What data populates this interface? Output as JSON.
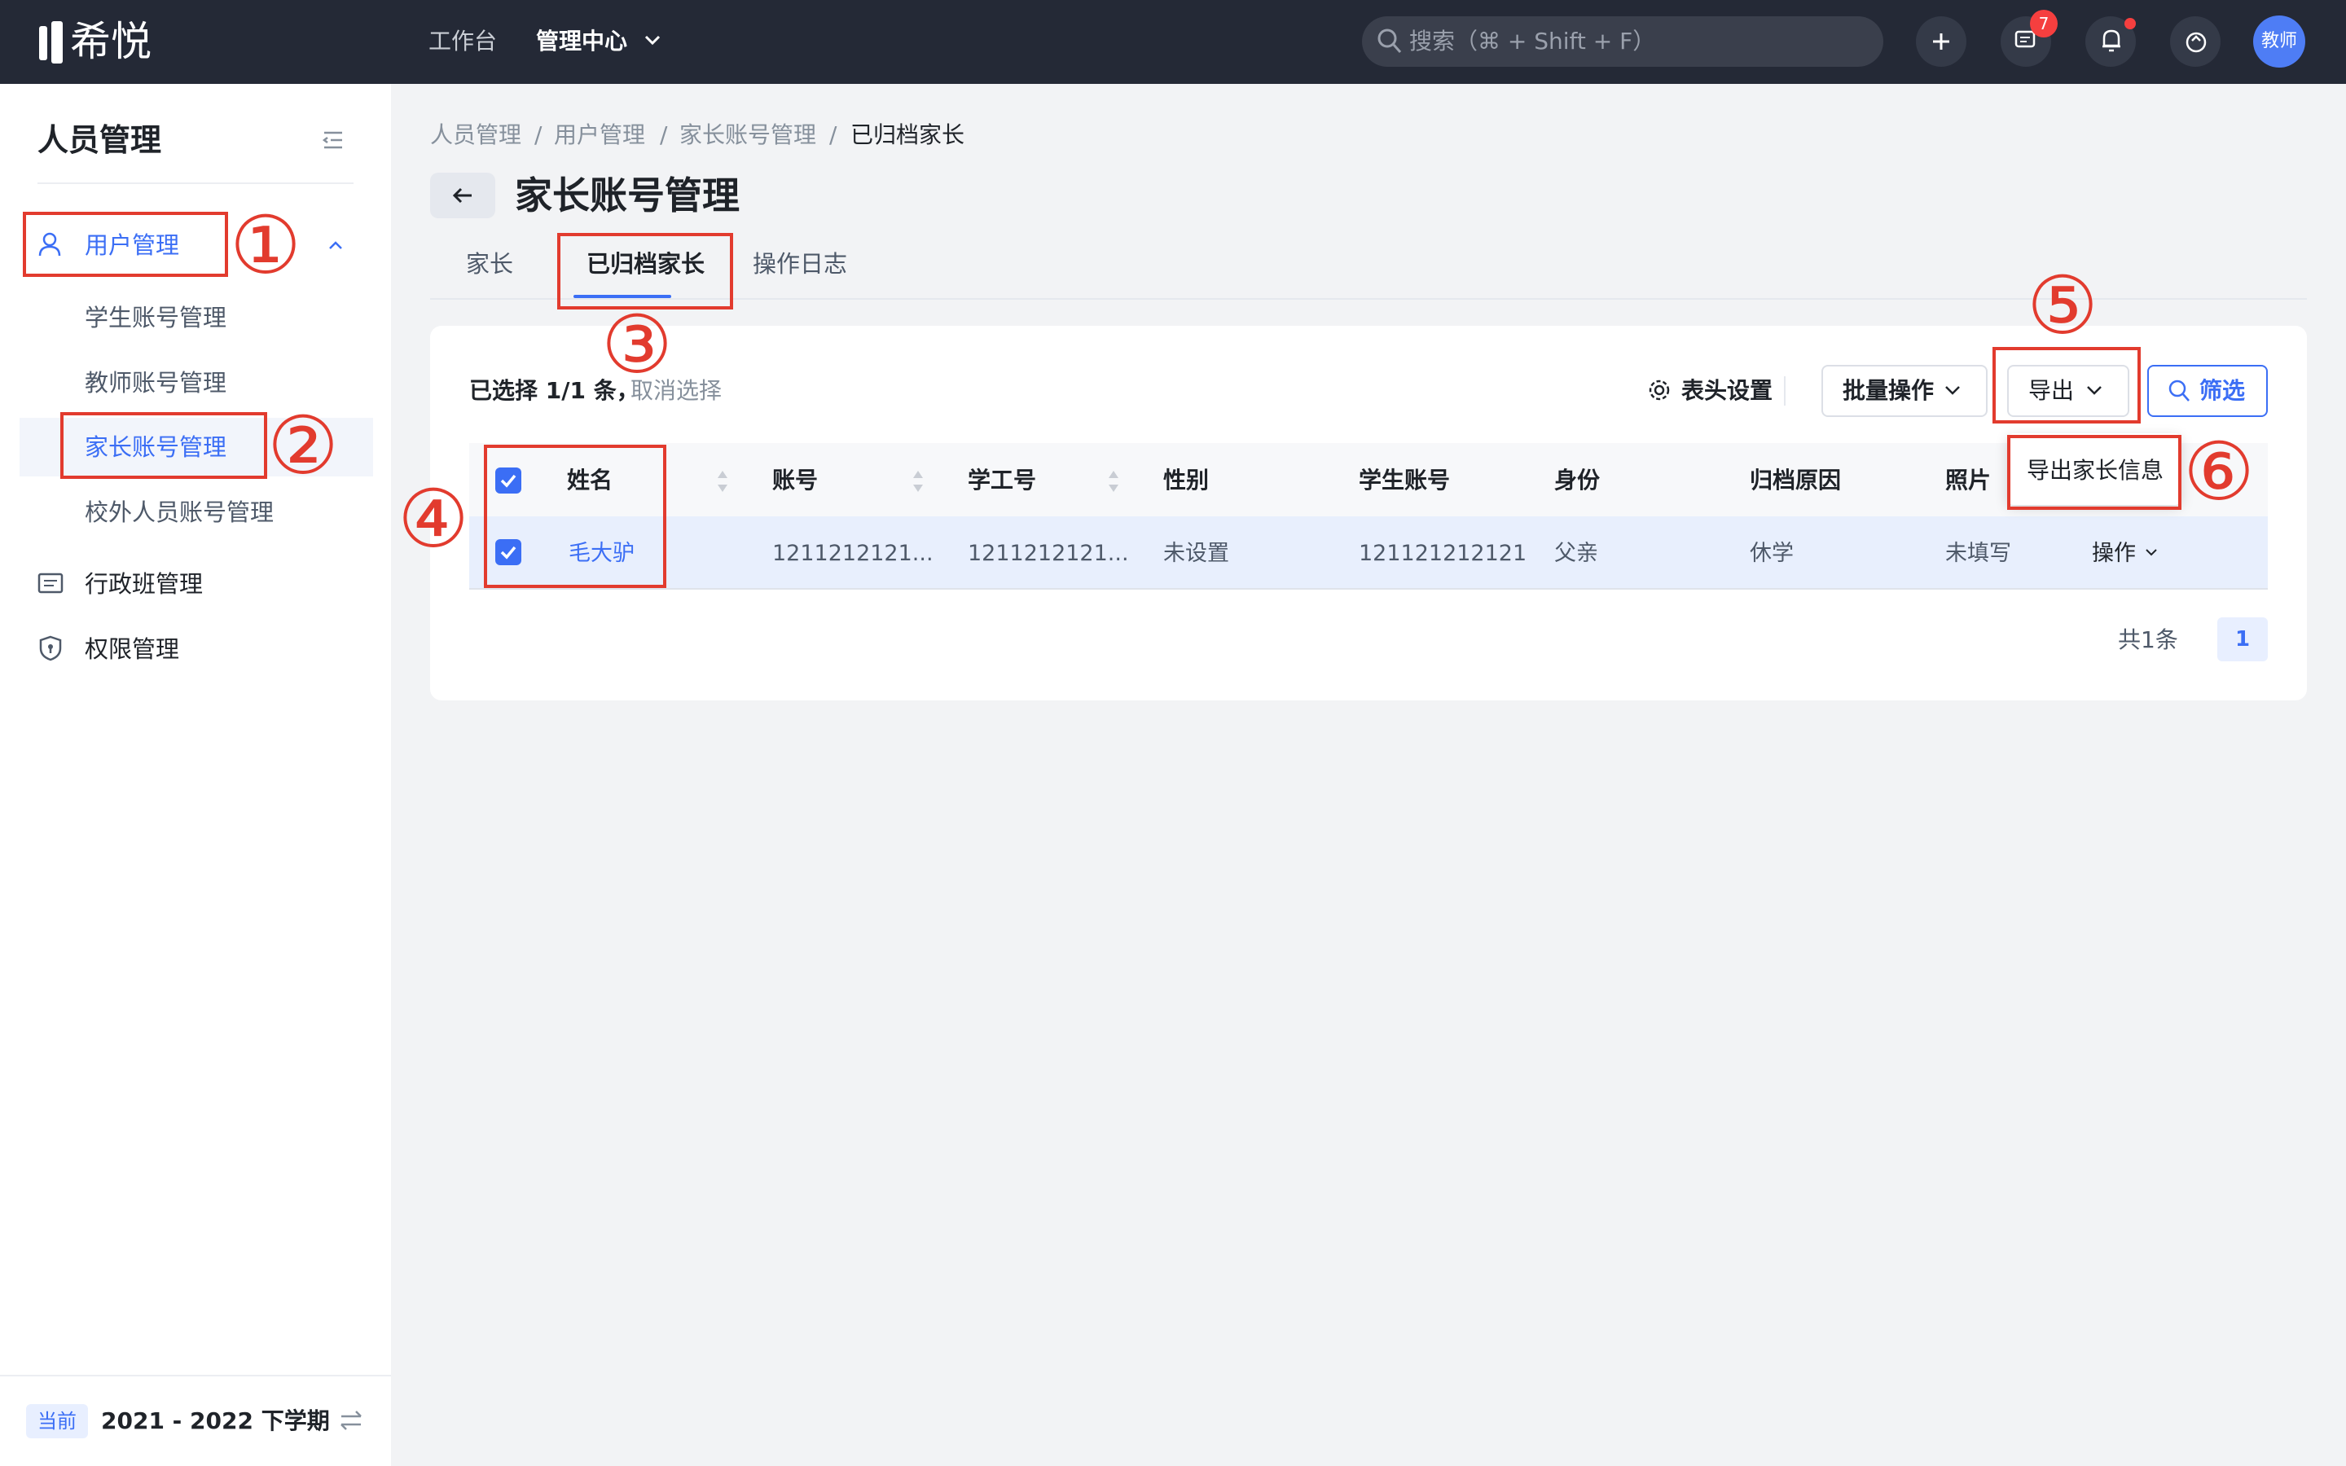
{
  "app": {
    "logo_text": "希悦"
  },
  "topnav": {
    "workbench": "工作台",
    "management": "管理中心",
    "search_placeholder": "搜索（⌘ + Shift + F）",
    "message_badge": "7",
    "avatar_label": "教师"
  },
  "sidebar": {
    "title": "人员管理",
    "items": [
      {
        "label": "用户管理"
      },
      {
        "label": "学生账号管理"
      },
      {
        "label": "教师账号管理"
      },
      {
        "label": "家长账号管理"
      },
      {
        "label": "校外人员账号管理"
      },
      {
        "label": "行政班管理"
      },
      {
        "label": "权限管理"
      }
    ],
    "term_tag": "当前",
    "term": "2021 - 2022 下学期"
  },
  "breadcrumb": [
    "人员管理",
    "用户管理",
    "家长账号管理",
    "已归档家长"
  ],
  "breadcrumb_sep": "/",
  "page_title": "家长账号管理",
  "tabs": [
    "家长",
    "已归档家长",
    "操作日志"
  ],
  "toolbar": {
    "selected": "已选择 1/1 条，",
    "cancel": "取消选择",
    "header_settings": "表头设置",
    "batch": "批量操作",
    "export": "导出",
    "filter": "筛选"
  },
  "table": {
    "columns": [
      "姓名",
      "账号",
      "学工号",
      "性别",
      "学生账号",
      "身份",
      "归档原因",
      "照片"
    ],
    "row": {
      "name": "毛大驴",
      "account": "1211212121...",
      "staff_no": "1211212121...",
      "gender": "未设置",
      "student_account": "121121212121",
      "identity": "父亲",
      "reason": "休学",
      "photo": "未填写",
      "action": "操作"
    }
  },
  "export_menu": {
    "item": "导出家长信息"
  },
  "pagination": {
    "total": "共1条",
    "current": "1"
  },
  "annotations": [
    "①",
    "②",
    "③",
    "④",
    "⑤",
    "⑥"
  ],
  "colors": {
    "accent": "#3b6ef5",
    "annotation": "#e23b2e",
    "topbar": "#242936"
  }
}
